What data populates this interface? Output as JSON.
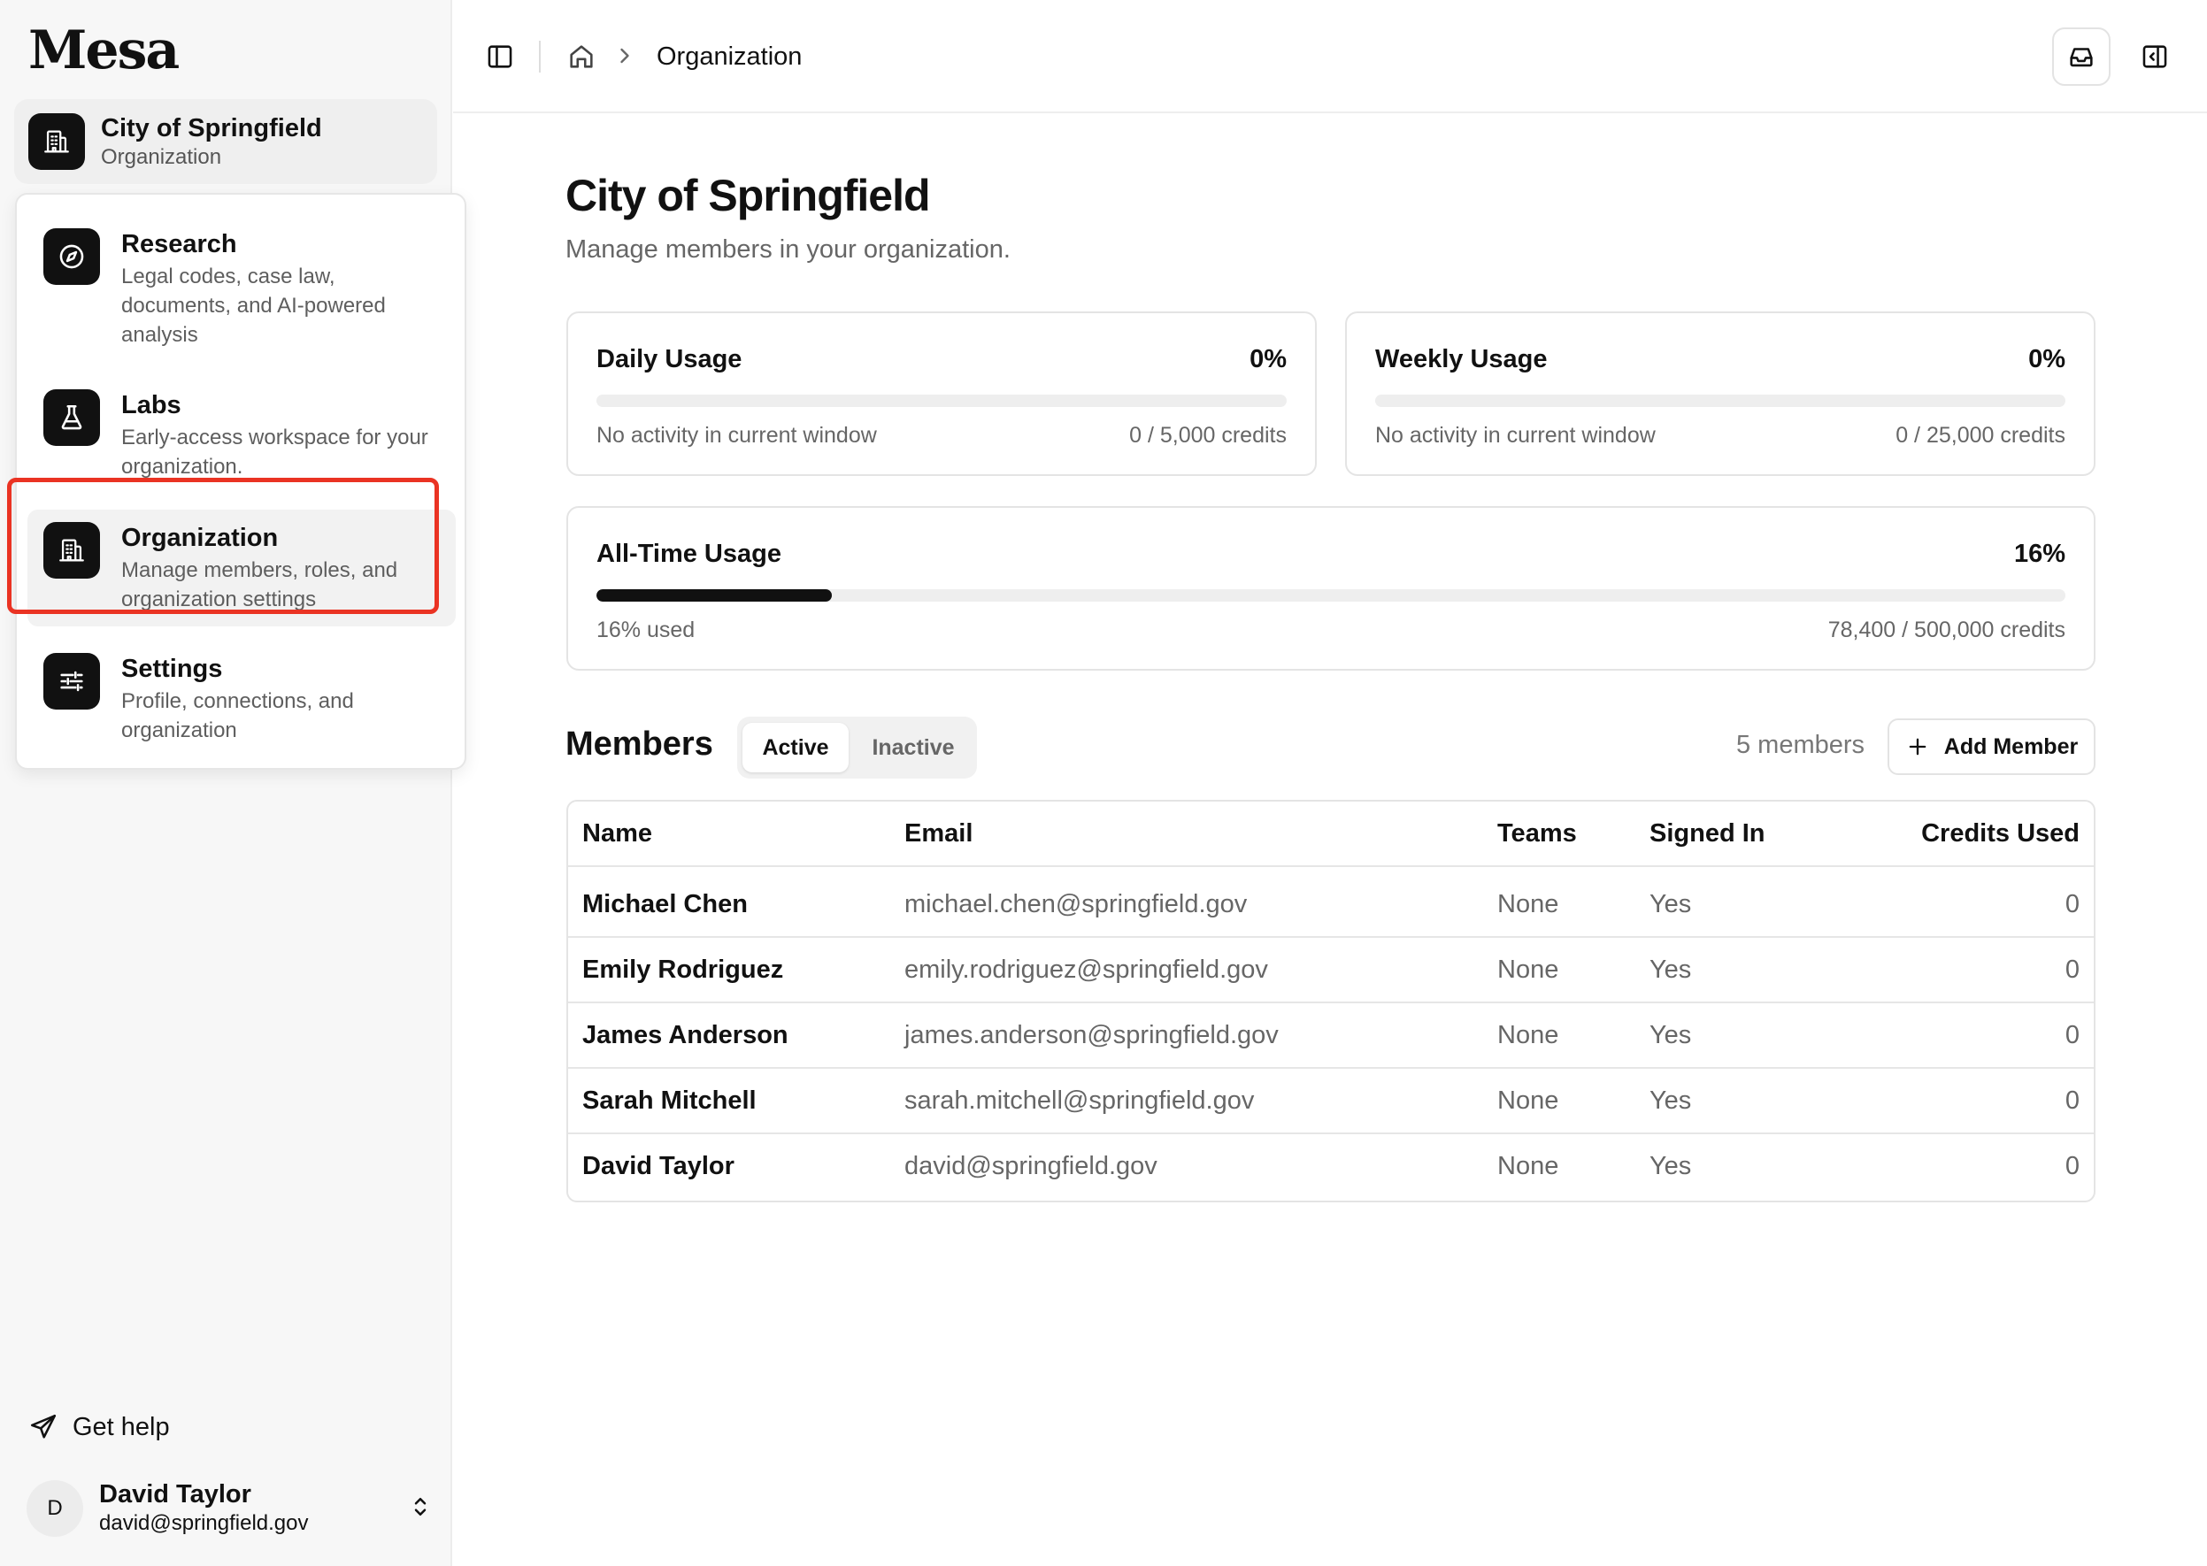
{
  "sidebar": {
    "logo": "Mesa",
    "org": {
      "name": "City of Springfield",
      "type": "Organization"
    },
    "menu": [
      {
        "title": "Research",
        "desc": "Legal codes, case law, documents, and AI-powered analysis",
        "icon": "compass-icon"
      },
      {
        "title": "Labs",
        "desc": "Early-access workspace for your organization.",
        "icon": "flask-icon"
      },
      {
        "title": "Organization",
        "desc": "Manage members, roles, and organization settings",
        "icon": "building-icon",
        "active": true
      },
      {
        "title": "Settings",
        "desc": "Profile, connections, and organization",
        "icon": "sliders-icon"
      }
    ],
    "help": "Get help",
    "user": {
      "initial": "D",
      "name": "David Taylor",
      "email": "david@springfield.gov"
    }
  },
  "header": {
    "breadcrumb": "Organization"
  },
  "main": {
    "title": "City of Springfield",
    "subtitle": "Manage members in your organization.",
    "usage": {
      "daily": {
        "title": "Daily Usage",
        "percent": "0%",
        "fill": 0,
        "note": "No activity in current window",
        "credits": "0 / 5,000 credits"
      },
      "weekly": {
        "title": "Weekly Usage",
        "percent": "0%",
        "fill": 0,
        "note": "No activity in current window",
        "credits": "0 / 25,000 credits"
      },
      "alltime": {
        "title": "All-Time Usage",
        "percent": "16%",
        "fill": 0.16,
        "note": "16% used",
        "credits": "78,400 / 500,000 credits"
      }
    },
    "members": {
      "title": "Members",
      "tabs": {
        "active": "Active",
        "inactive": "Inactive"
      },
      "count": "5 members",
      "add_label": "Add Member",
      "columns": {
        "name": "Name",
        "email": "Email",
        "teams": "Teams",
        "signed": "Signed In",
        "credits": "Credits Used"
      },
      "rows": [
        {
          "name": "Michael Chen",
          "email": "michael.chen@springfield.gov",
          "teams": "None",
          "signed": "Yes",
          "credits": "0"
        },
        {
          "name": "Emily Rodriguez",
          "email": "emily.rodriguez@springfield.gov",
          "teams": "None",
          "signed": "Yes",
          "credits": "0"
        },
        {
          "name": "James Anderson",
          "email": "james.anderson@springfield.gov",
          "teams": "None",
          "signed": "Yes",
          "credits": "0"
        },
        {
          "name": "Sarah Mitchell",
          "email": "sarah.mitchell@springfield.gov",
          "teams": "None",
          "signed": "Yes",
          "credits": "0"
        },
        {
          "name": "David Taylor",
          "email": "david@springfield.gov",
          "teams": "None",
          "signed": "Yes",
          "credits": "0"
        }
      ]
    }
  },
  "colors": {
    "accent": "#111111",
    "highlight": "#ea3323",
    "muted": "#666666",
    "border": "#e4e4e4"
  }
}
